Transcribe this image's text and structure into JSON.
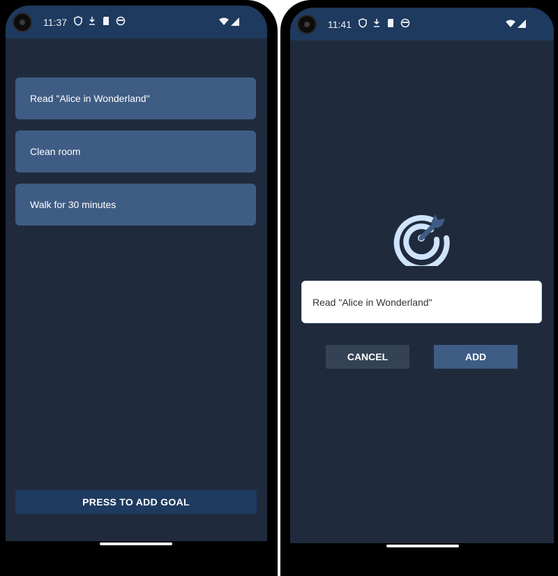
{
  "left_screen": {
    "status": {
      "time": "11:37"
    },
    "goals": [
      {
        "label": "Read \"Alice in Wonderland\""
      },
      {
        "label": "Clean room"
      },
      {
        "label": "Walk for 30 minutes"
      }
    ],
    "add_goal_button": {
      "label": "PRESS TO ADD GOAL"
    }
  },
  "right_screen": {
    "status": {
      "time": "11:41"
    },
    "logo_icon": "target-arrow-icon",
    "goal_input": {
      "value": "Read \"Alice in Wonderland\""
    },
    "cancel_button": {
      "label": "CANCEL"
    },
    "add_button": {
      "label": "ADD"
    }
  },
  "colors": {
    "screen_bg": "#1f2b3d",
    "status_bar": "#1e3a5f",
    "goal_item": "#3f5c84",
    "cancel_button": "#344255",
    "add_button": "#3f5c84",
    "logo_light": "#cfe4fb",
    "logo_dark": "#3f5c84"
  }
}
